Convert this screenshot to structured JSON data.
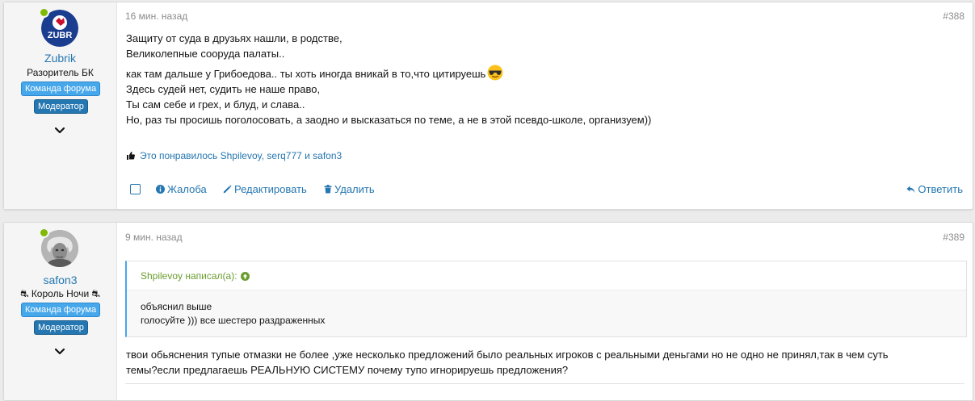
{
  "posts": [
    {
      "user": {
        "name": "Zubrik",
        "title": "Разоритель БК",
        "banners": [
          "Команда форума",
          "Модератор"
        ],
        "avatar_text": "ZUBR",
        "online": true
      },
      "time": "16 мин. назад",
      "number": "#388",
      "lines": [
        "Защиту от суда в друзьях нашли, в родстве,",
        "Великолепные сооруда палаты..",
        "как там дальше у Грибоедова.. ты хоть иногда вникай в то,что цитируешь",
        "Здесь судей нет, судить не наше право,",
        "Ты сам себе и грех, и блуд, и слава..",
        "Но, раз ты просишь поголосовать, а заодно и высказаться по теме, а не в этой псевдо-школе, организуем))"
      ],
      "likes": "Это понравилось Shpilevoy, serq777 и safon3",
      "actions": {
        "report": "Жалоба",
        "edit": "Редактировать",
        "delete": "Удалить",
        "reply": "Ответить"
      }
    },
    {
      "user": {
        "name": "safon3",
        "title": "⛐ Король Ночи ⛐",
        "banners": [
          "Команда форума",
          "Модератор"
        ],
        "online": true
      },
      "time": "9 мин. назад",
      "number": "#389",
      "quote": {
        "author": "Shpilevoy написал(а):",
        "lines": [
          "объяснил выше",
          "голосуйте ))) все шестеро раздраженных"
        ]
      },
      "lines": [
        "твои обьяснения тупые отмазки не более ,уже несколько предложений было реальных игроков с реальными деньгами но не одно не принял,так в чем суть",
        "темы?если предлагаешь РЕАЛЬНУЮ СИСТЕМУ почему тупо игнорируешь предложения?"
      ]
    }
  ],
  "colors": {
    "link": "#2577b1",
    "online": "#7fb900",
    "quote_author": "#6a9d2f",
    "banner_team": "#47a7eb",
    "banner_mod": "#2577b1"
  },
  "icons": [
    "chevron-down-icon",
    "thumbs-up-icon",
    "info-icon",
    "pencil-icon",
    "trash-icon",
    "reply-icon",
    "arrow-up-circle-icon",
    "sunglasses-emoji-icon"
  ]
}
